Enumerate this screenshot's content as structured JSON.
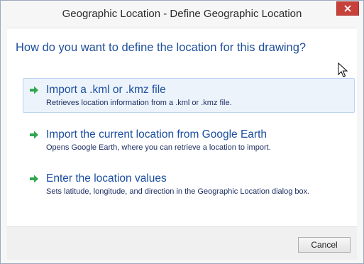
{
  "window": {
    "title": "Geographic Location - Define Geographic Location"
  },
  "main_instruction": "How do you want to define the location for this drawing?",
  "options": [
    {
      "title": "Import a .kml or .kmz file",
      "description": "Retrieves location information from a .kml or .kmz file.",
      "icon": "green-arrow-icon"
    },
    {
      "title": "Import the current location from Google Earth",
      "description": "Opens Google Earth, where you can retrieve a location to import.",
      "icon": "green-arrow-icon"
    },
    {
      "title": "Enter the location values",
      "description": "Sets  latitude, longitude, and direction in the Geographic Location dialog box.",
      "icon": "green-arrow-icon"
    }
  ],
  "footer": {
    "cancel_label": "Cancel"
  },
  "colors": {
    "close_button": "#c7413b",
    "instruction_text": "#1e4e9a",
    "arrow_green": "#2fa84f",
    "hover_background": "#ecf3fb"
  }
}
